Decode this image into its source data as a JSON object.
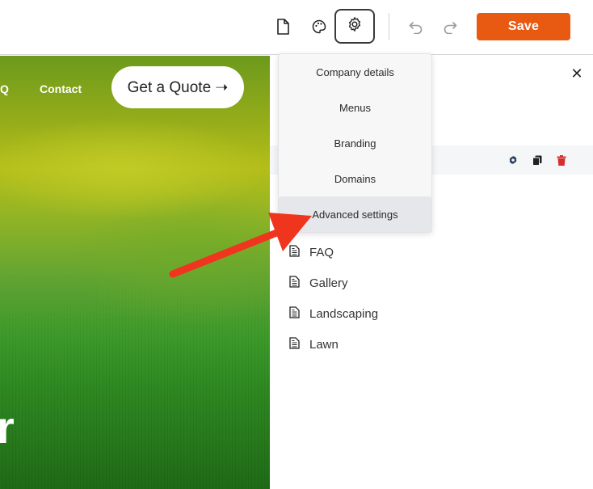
{
  "toolbar": {
    "page_icon": "page-icon",
    "palette_icon": "palette-icon",
    "settings_icon": "gear-icon",
    "undo_icon": "undo-icon",
    "redo_icon": "redo-icon",
    "save_label": "Save"
  },
  "preview": {
    "nav_partial": "Q",
    "nav_contact": "Contact",
    "quote_button": "Get a Quote ➝",
    "hero_partial": "r"
  },
  "settings_menu": {
    "items": [
      {
        "label": "Company details"
      },
      {
        "label": "Menus"
      },
      {
        "label": "Branding"
      },
      {
        "label": "Domains"
      },
      {
        "label": "Advanced settings"
      }
    ]
  },
  "panel": {
    "close_symbol": "✕",
    "selected_row_actions": [
      "gear-icon",
      "copy-icon",
      "trash-icon"
    ],
    "pages": [
      {
        "label": "FAQ"
      },
      {
        "label": "Gallery"
      },
      {
        "label": "Landscaping"
      },
      {
        "label": "Lawn"
      }
    ]
  },
  "colors": {
    "save": "#e85a12",
    "arrow": "#f0351e",
    "trash": "#d62f2f"
  }
}
